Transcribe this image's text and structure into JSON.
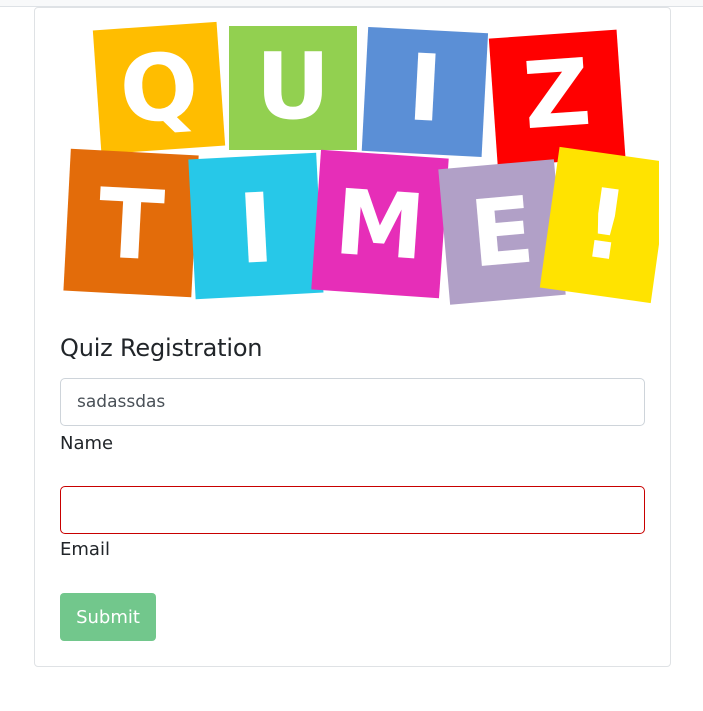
{
  "banner": {
    "row1": [
      {
        "letter": "Q",
        "color": "#ffbd00"
      },
      {
        "letter": "U",
        "color": "#92d050"
      },
      {
        "letter": "I",
        "color": "#5b8fd6"
      },
      {
        "letter": "Z",
        "color": "#ff0000"
      }
    ],
    "row2": [
      {
        "letter": "T",
        "color": "#e36c0a"
      },
      {
        "letter": "I",
        "color": "#27c8e8"
      },
      {
        "letter": "M",
        "color": "#e62eb8"
      },
      {
        "letter": "E",
        "color": "#b1a0c7"
      },
      {
        "letter": "!",
        "color": "#ffe300"
      }
    ]
  },
  "form": {
    "title": "Quiz Registration",
    "name_value": "sadassdas",
    "name_label": "Name",
    "email_value": "",
    "email_label": "Email",
    "submit_label": "Submit"
  }
}
